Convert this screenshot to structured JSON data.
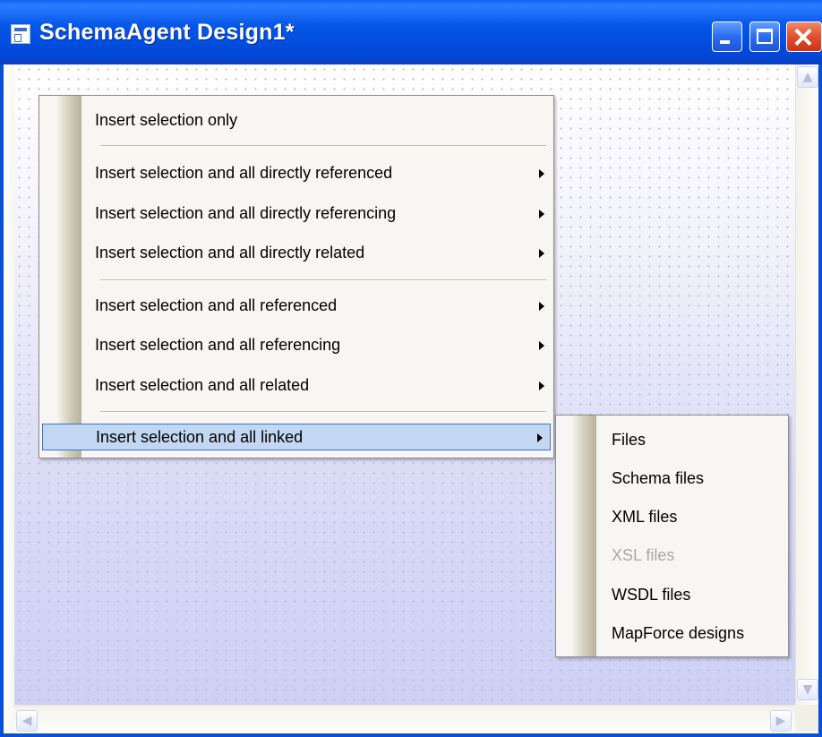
{
  "window": {
    "title": "SchemaAgent Design1*"
  },
  "context_menu": {
    "items": [
      {
        "label": "Insert selection only",
        "submenu": false
      },
      {
        "label": "Insert selection and all directly referenced",
        "submenu": true
      },
      {
        "label": "Insert selection and all directly referencing",
        "submenu": true
      },
      {
        "label": "Insert selection and all directly related",
        "submenu": true
      },
      {
        "label": "Insert selection and all referenced",
        "submenu": true
      },
      {
        "label": "Insert selection and all referencing",
        "submenu": true
      },
      {
        "label": "Insert selection and all related",
        "submenu": true
      },
      {
        "label": "Insert selection and all linked",
        "submenu": true,
        "highlighted": true
      }
    ]
  },
  "submenu": {
    "items": [
      {
        "label": "Files",
        "enabled": true
      },
      {
        "label": "Schema files",
        "enabled": true
      },
      {
        "label": "XML files",
        "enabled": true
      },
      {
        "label": "XSL files",
        "enabled": false
      },
      {
        "label": "WSDL files",
        "enabled": true
      },
      {
        "label": "MapForce designs",
        "enabled": true
      }
    ]
  },
  "colors": {
    "titlebar": "#0048d8",
    "highlight": "#c3d7f3",
    "highlight_border": "#3b6fd1",
    "disabled_text": "#a9a9a9"
  }
}
